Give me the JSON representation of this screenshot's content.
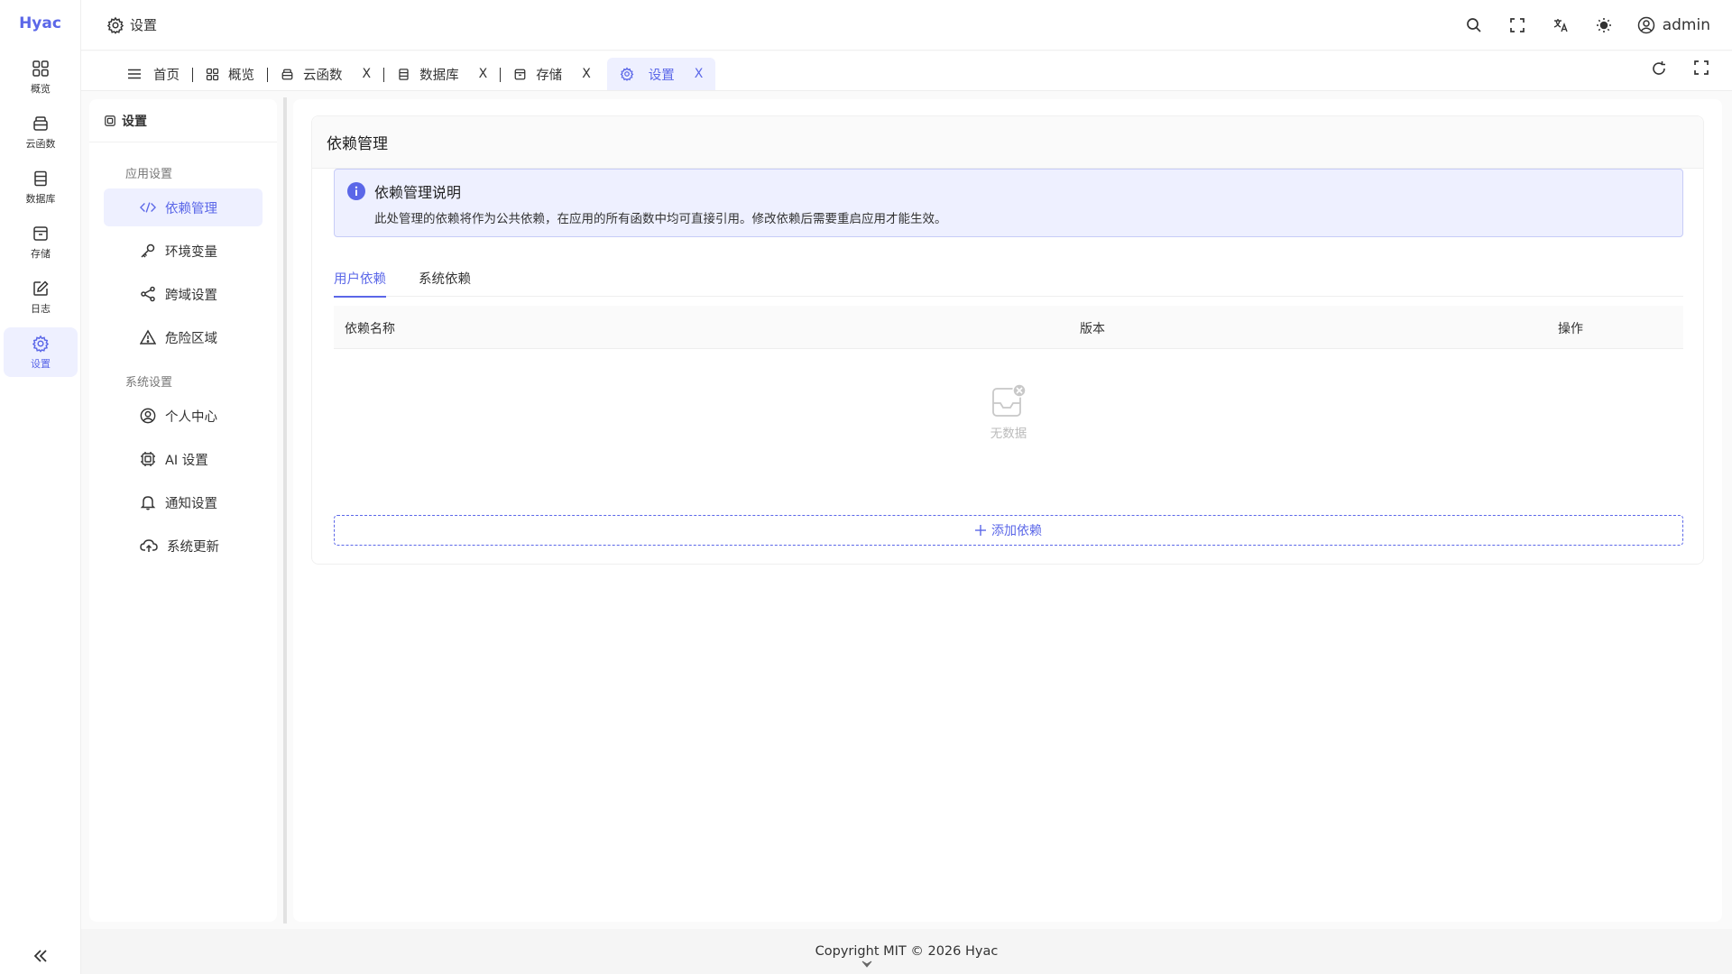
{
  "brand": "Hyac",
  "rail": {
    "items": [
      {
        "label": "概览",
        "icon": "dashboard-icon"
      },
      {
        "label": "云函数",
        "icon": "cloud-function-icon"
      },
      {
        "label": "数据库",
        "icon": "database-icon"
      },
      {
        "label": "存储",
        "icon": "storage-icon"
      },
      {
        "label": "日志",
        "icon": "log-icon"
      },
      {
        "label": "设置",
        "icon": "gear-icon",
        "active": true
      }
    ]
  },
  "header": {
    "title": "设置",
    "user": "admin"
  },
  "tabs": [
    {
      "label": "首页"
    },
    {
      "label": "概览"
    },
    {
      "label": "云函数",
      "close": "X"
    },
    {
      "label": "数据库",
      "close": "X"
    },
    {
      "label": "存储",
      "close": "X"
    },
    {
      "label": "设置",
      "close": "X",
      "active": true
    }
  ],
  "settings_nav": {
    "title": "设置",
    "app_group": "应用设置",
    "app_items": [
      {
        "label": "依赖管理",
        "icon": "code-icon",
        "active": true
      },
      {
        "label": "环境变量",
        "icon": "key-icon"
      },
      {
        "label": "跨域设置",
        "icon": "share-icon"
      },
      {
        "label": "危险区域",
        "icon": "warning-icon"
      }
    ],
    "system_group": "系统设置",
    "system_items": [
      {
        "label": "个人中心",
        "icon": "user-circle-icon"
      },
      {
        "label": "AI 设置",
        "icon": "chip-icon"
      },
      {
        "label": "通知设置",
        "icon": "bell-icon"
      },
      {
        "label": "系统更新",
        "icon": "cloud-upload-icon"
      }
    ]
  },
  "main": {
    "card_title": "依赖管理",
    "alert": {
      "title": "依赖管理说明",
      "desc": "此处管理的依赖将作为公共依赖，在应用的所有函数中均可直接引用。修改依赖后需要重启应用才能生效。"
    },
    "subtabs": [
      "用户依赖",
      "系统依赖"
    ],
    "table": {
      "columns": [
        "依赖名称",
        "版本",
        "操作"
      ],
      "empty_text": "无数据"
    },
    "add_button": "添加依赖"
  },
  "footer": "Copyright MIT © 2026 Hyac",
  "colors": {
    "accent": "#5b67e8",
    "accent_bg": "#eef0ff"
  }
}
